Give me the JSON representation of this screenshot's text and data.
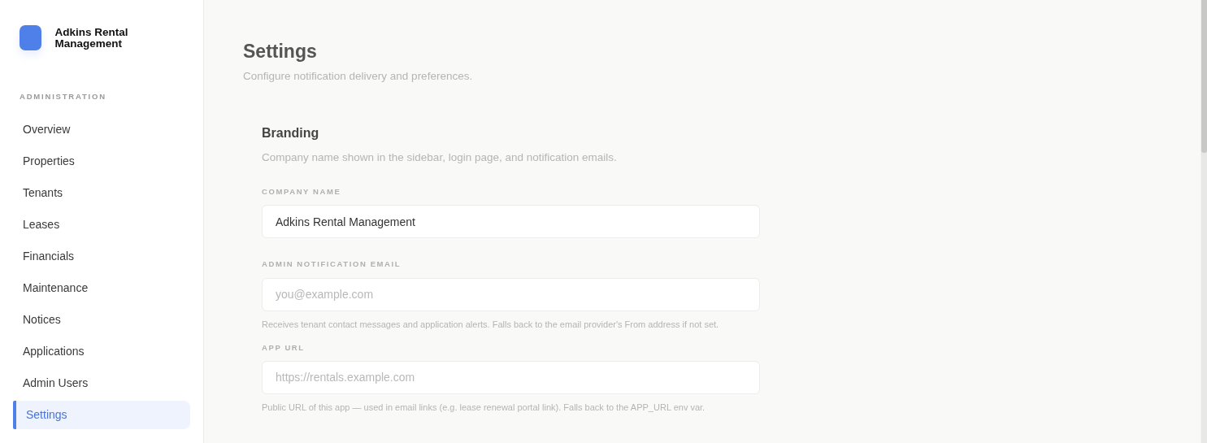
{
  "brand": {
    "name": "Adkins Rental Management"
  },
  "sidebar": {
    "section": "ADMINISTRATION",
    "items": [
      {
        "label": "Overview",
        "selected": false
      },
      {
        "label": "Properties",
        "selected": false
      },
      {
        "label": "Tenants",
        "selected": false
      },
      {
        "label": "Leases",
        "selected": false
      },
      {
        "label": "Financials",
        "selected": false
      },
      {
        "label": "Maintenance",
        "selected": false
      },
      {
        "label": "Notices",
        "selected": false
      },
      {
        "label": "Applications",
        "selected": false
      },
      {
        "label": "Admin Users",
        "selected": false
      },
      {
        "label": "Settings",
        "selected": true
      }
    ]
  },
  "page": {
    "title": "Settings",
    "subtitle": "Configure notification delivery and preferences."
  },
  "section": {
    "title": "Branding",
    "description": "Company name shown in the sidebar, login page, and notification emails.",
    "fields": [
      {
        "label": "COMPANY NAME",
        "value": "Adkins Rental Management"
      },
      {
        "label": "ADMIN NOTIFICATION EMAIL",
        "placeholder": "you@example.com",
        "help": "Receives tenant contact messages and application alerts. Falls back to the email provider's From address if not set."
      },
      {
        "label": "APP URL",
        "placeholder": "https://rentals.example.com",
        "help": "Public URL of this app — used in email links (e.g. lease renewal portal link). Falls back to the APP_URL env var."
      }
    ]
  }
}
